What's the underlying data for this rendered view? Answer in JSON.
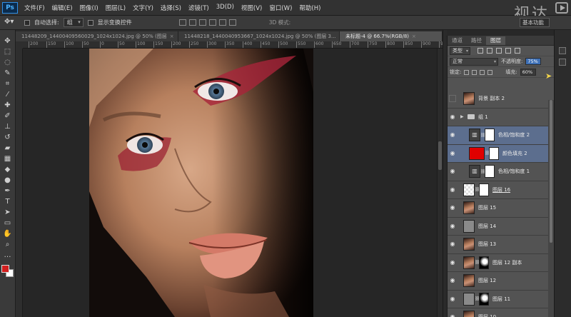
{
  "menu": {
    "logo": "Ps",
    "items": [
      "文件(F)",
      "编辑(E)",
      "图像(I)",
      "图层(L)",
      "文字(Y)",
      "选择(S)",
      "滤镜(T)",
      "3D(D)",
      "视图(V)",
      "窗口(W)",
      "帮助(H)"
    ]
  },
  "watermark": "视达",
  "options": {
    "auto_select_label": "自动选择:",
    "auto_select_value": "组",
    "show_transform_label": "显示变换控件",
    "mode_3d": "3D 模式:",
    "workspace": "基本功能"
  },
  "tabs": [
    {
      "label": "11448209_14400409560029_1024x1024.jpg @ 50% (图层",
      "active": false
    },
    {
      "label": "11448218_1440040953667_1024x1024.jpg @ 50% (图层 3...",
      "active": false
    },
    {
      "label": "未标题-4 @ 66.7%(RGB/8)",
      "active": true
    }
  ],
  "ruler_h": [
    "200",
    "150",
    "100",
    "50",
    "0",
    "50",
    "100",
    "150",
    "200",
    "250",
    "300",
    "350",
    "400",
    "450",
    "500",
    "550",
    "600",
    "650",
    "700",
    "750",
    "800",
    "850",
    "900",
    "950"
  ],
  "panel": {
    "tabs": [
      "通道",
      "路径",
      "图层"
    ],
    "active_tab": "图层",
    "filter_kind": "类型",
    "blend_mode": "正常",
    "opacity_label": "不透明度:",
    "opacity_value": "75%",
    "lock_label": "锁定:",
    "fill_label": "填充:",
    "fill_value": "60%"
  },
  "layers": [
    {
      "name": "背景 副本 2",
      "thumb": "face",
      "visible": false,
      "selected": false,
      "indent": false
    },
    {
      "name": "组 1",
      "thumb": "folder",
      "visible": true,
      "selected": false,
      "indent": false
    },
    {
      "name": "色相/饱和度 2",
      "thumb": "adj",
      "visible": true,
      "selected": true,
      "indent": true,
      "mask": "white"
    },
    {
      "name": "颜色填充 2",
      "thumb": "red",
      "visible": true,
      "selected": true,
      "indent": true,
      "mask": "white"
    },
    {
      "name": "色相/饱和度 1",
      "thumb": "adj",
      "visible": true,
      "selected": false,
      "indent": true,
      "mask": "white"
    },
    {
      "name": "图层 16",
      "thumb": "check",
      "visible": true,
      "selected": false,
      "indent": false,
      "mask": "white",
      "underline": true
    },
    {
      "name": "图层 15",
      "thumb": "face",
      "visible": true,
      "selected": false,
      "indent": false
    },
    {
      "name": "图层 14",
      "thumb": "gray",
      "visible": true,
      "selected": false,
      "indent": false
    },
    {
      "name": "图层 13",
      "thumb": "face",
      "visible": true,
      "selected": false,
      "indent": false
    },
    {
      "name": "图层 12 副本",
      "thumb": "face",
      "visible": true,
      "selected": false,
      "indent": false,
      "mask": "dark"
    },
    {
      "name": "图层 12",
      "thumb": "face",
      "visible": true,
      "selected": false,
      "indent": false
    },
    {
      "name": "图层 11",
      "thumb": "gray",
      "visible": true,
      "selected": false,
      "indent": false,
      "mask": "dark"
    },
    {
      "name": "图层 10",
      "thumb": "face",
      "visible": true,
      "selected": false,
      "indent": false
    }
  ],
  "colors": {
    "foreground": "#d21f1f",
    "background": "#ffffff",
    "selection": "#5c6e8e"
  }
}
